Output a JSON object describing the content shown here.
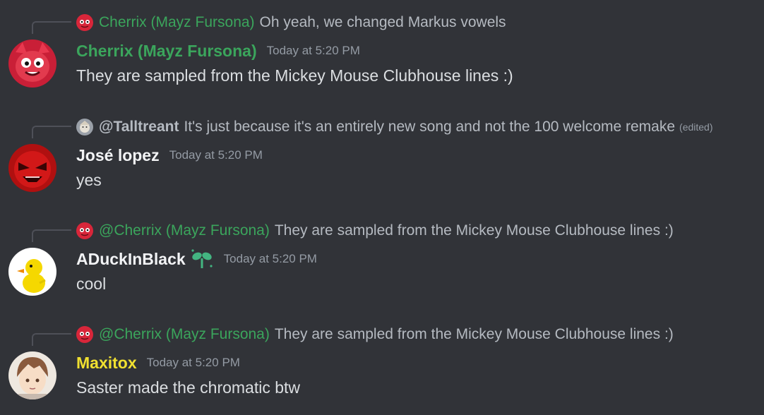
{
  "colors": {
    "background": "#313338",
    "cherrix": "#3ba55c",
    "jose": "#f2f3f5",
    "aduck": "#f2f3f5",
    "maxitox": "#f0e030",
    "timestamp": "#949ba4",
    "body_text": "#dbdee1",
    "reply_text": "#b5bac1"
  },
  "messages": [
    {
      "reply": {
        "author": "Cherrix (Mayz Fursona)",
        "text": "Oh yeah, we changed Markus vowels",
        "edited": ""
      },
      "author": "Cherrix (Mayz Fursona)",
      "timestamp": "Today at 5:20 PM",
      "content": "They are sampled from the Mickey Mouse Clubhouse lines :)",
      "avatar_icon": "red-fox-avatar"
    },
    {
      "reply": {
        "author": "@Talltreant",
        "text": "It's just because it's an entirely new song and not the 100 welcome remake",
        "edited": "(edited)"
      },
      "author": "José lopez",
      "timestamp": "Today at 5:20 PM",
      "content": "yes",
      "avatar_icon": "red-character-avatar"
    },
    {
      "reply": {
        "author": "@Cherrix (Mayz Fursona)",
        "text": "They are sampled from the Mickey Mouse Clubhouse lines :)",
        "edited": ""
      },
      "author": "ADuckInBlack",
      "timestamp": "Today at 5:20 PM",
      "content": "cool",
      "avatar_icon": "yellow-duck-avatar"
    },
    {
      "reply": {
        "author": "@Cherrix (Mayz Fursona)",
        "text": "They are sampled from the Mickey Mouse Clubhouse lines :)",
        "edited": ""
      },
      "author": "Maxitox",
      "timestamp": "Today at 5:20 PM",
      "content": "Saster made the chromatic btw",
      "avatar_icon": "anime-boy-avatar"
    }
  ]
}
